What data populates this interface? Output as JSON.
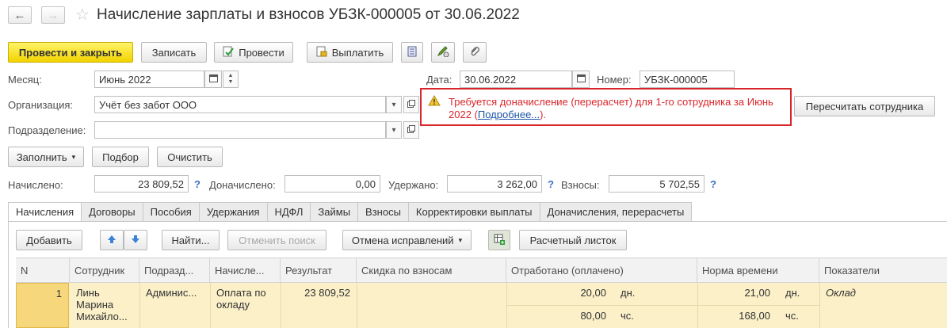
{
  "window": {
    "title": "Начисление зарплаты и взносов УБЗК-000005 от 30.06.2022",
    "back_icon": "←",
    "forward_icon": "→",
    "favorite_icon": "☆"
  },
  "toolbar": {
    "post_close": "Провести и закрыть",
    "save": "Записать",
    "post": "Провести",
    "pay": "Выплатить"
  },
  "form": {
    "month_label": "Месяц:",
    "month_value": "Июнь 2022",
    "date_label": "Дата:",
    "date_value": "30.06.2022",
    "number_label": "Номер:",
    "number_value": "УБЗК-000005",
    "org_label": "Организация:",
    "org_value": "Учёт без забот ООО",
    "dept_label": "Подразделение:",
    "dept_value": ""
  },
  "warning": {
    "text": "Требуется доначисление (перерасчет) для 1-го сотрудника за Июнь 2022 (",
    "link": "Подробнее...",
    "tail": ").",
    "color": "#d9262c"
  },
  "recalc_button": "Пересчитать сотрудника",
  "actions": {
    "fill": "Заполнить",
    "select": "Подбор",
    "clear": "Очистить"
  },
  "totals": {
    "accrued_label": "Начислено:",
    "accrued_value": "23 809,52",
    "additional_label": "Доначислено:",
    "additional_value": "0,00",
    "withheld_label": "Удержано:",
    "withheld_value": "3 262,00",
    "contrib_label": "Взносы:",
    "contrib_value": "5 702,55",
    "help": "?"
  },
  "tabs": [
    "Начисления",
    "Договоры",
    "Пособия",
    "Удержания",
    "НДФЛ",
    "Займы",
    "Взносы",
    "Корректировки выплаты",
    "Доначисления, перерасчеты"
  ],
  "table_toolbar": {
    "add": "Добавить",
    "find": "Найти...",
    "cancel_search": "Отменить поиск",
    "cancel_corrections": "Отмена исправлений",
    "payslip": "Расчетный листок"
  },
  "table": {
    "headers": [
      "N",
      "Сотрудник",
      "Подразд...",
      "Начисле...",
      "Результат",
      "Скидка по взносам",
      "Отработано (оплачено)",
      "Норма времени",
      "Показатели"
    ],
    "row": {
      "n": "1",
      "employee": "Линь Марина Михайло...",
      "dept": "Админис...",
      "accrual": "Оплата по окладу",
      "result": "23 809,52",
      "discount": "",
      "worked_days": "20,00",
      "worked_days_unit": "дн.",
      "worked_hours": "80,00",
      "worked_hours_unit": "чс.",
      "norm_days": "21,00",
      "norm_days_unit": "дн.",
      "norm_hours": "168,00",
      "norm_hours_unit": "чс.",
      "indicator": "Оклад"
    }
  }
}
